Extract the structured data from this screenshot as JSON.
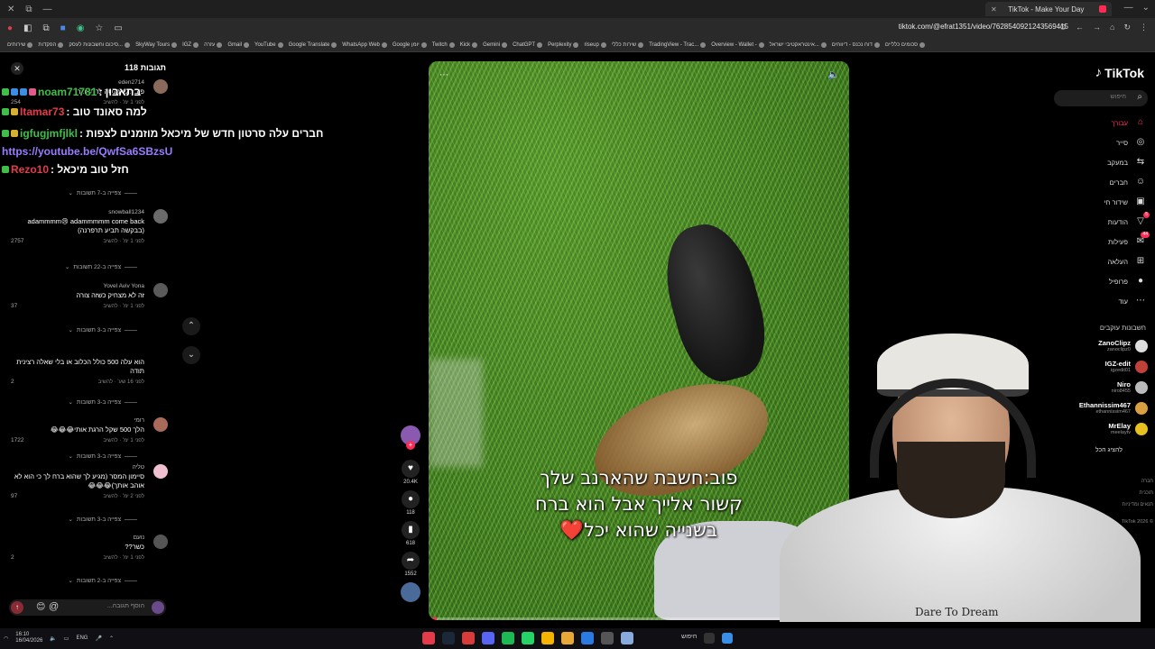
{
  "browser": {
    "tab_title": "TikTok - Make Your Day",
    "url": "tiktok.com/@efrat1351/video/7628540921243569415",
    "bookmarks": [
      "סכומים כלליים",
      "דוח נכנס - דיווחים",
      "אינטראקטיבי ישראל...",
      "Overview - Wallet -",
      "TradingView - Trac...",
      "שירות כללי",
      "riseup",
      "Perplexity",
      "ChatGPT",
      "Gemini",
      "Kick",
      "Twitch",
      "Google יומן",
      "WhatsApp Web",
      "Google Translate",
      "YouTube",
      "Gmail",
      "עזרה",
      "IGZ",
      "SkyWay Tours",
      "סיכום וחשבונות לעסק...",
      "הפקדות",
      "שירותים"
    ]
  },
  "comments": {
    "header": "תגובות",
    "count": "118",
    "close_icon": "close-icon",
    "items": [
      {
        "user": "eden2714",
        "text": "פוב: אני מנסה להתעורר",
        "meta": "לפני 1 ימ' · להשיב",
        "likes": "254",
        "replies": "צפייה ב-7 תשובות"
      },
      {
        "user": "snowball1234",
        "text": "adammmm😢 adammmmm come back (בבקשה תביע תרפרנה)",
        "meta": "לפני 1 ימ' · להשיב",
        "likes": "2757",
        "replies": "צפייה ב-22 תשובות"
      },
      {
        "user": "Yovel Aviv Yona",
        "text": "זה לא מצחיק כשזה צורה",
        "meta": "לפני 1 ימ' · להשיב",
        "likes": "37",
        "replies": "צפייה ב-3 תשובות"
      },
      {
        "user": "",
        "text": "הוא עלה 500 כולל הכלוב או בלי שאלה רצינית תודה",
        "meta": "לפני 16 שע' · להשיב",
        "likes": "2",
        "replies": "צפייה ב-3 תשובות"
      },
      {
        "user": "רומי",
        "text": "הלך 500 שקל הרגת אותי😂😂😂",
        "meta": "לפני 1 ימ' · להשיב",
        "likes": "1722",
        "replies": "צפייה ב-3 תשובות"
      },
      {
        "user": "טליה",
        "text": "סיימון המסר (מגיע לך שהוא ברח לך כי הוא לא אוהב אותך)😂😂😂",
        "meta": "לפני 2 ימ' · להשיב",
        "likes": "97",
        "replies": "צפייה ב-3 תשובות"
      },
      {
        "user": "נועם",
        "text": "כשר??",
        "meta": "לפני 1 ימ' · להשיב",
        "likes": "2",
        "replies": "צפייה ב-2 תשובות"
      }
    ],
    "input_placeholder": "הוסף תגובה...",
    "emoji_icon": "😊",
    "at_symbol": "@"
  },
  "chat": [
    {
      "name": "noam71781",
      "name_color": "#3fbf4a",
      "msg": ": בתאבון"
    },
    {
      "name": "Itamar73",
      "name_color": "#e23b4a",
      "msg": ": למה סאונד טוב"
    },
    {
      "name": "igfugjmfjlkl",
      "name_color": "#3fbf4a",
      "msg": ": חברים עלה סרטון חדש של מיכאל מוזמנים לצפות"
    },
    {
      "name": "https://youtube.be/QwfSa6SBzsU",
      "name_color": "#9a7cff",
      "msg": ""
    },
    {
      "name": "Rezo10",
      "name_color": "#e23b4a",
      "msg": ": חזל טוב מיכאל"
    }
  ],
  "video": {
    "caption": [
      "פוב:חשבת שהארנב שלך",
      "קשור אלייך אבל הוא ברח",
      "בשנייה שהוא יכל"
    ],
    "caption_heart": "❤️",
    "progress": 0.02
  },
  "actions": {
    "likes": "20.4K",
    "comments": "118",
    "saves": "618",
    "shares": "1552"
  },
  "tiktok": {
    "logo": "TikTok",
    "search_placeholder": "חיפוש",
    "nav": [
      {
        "label": "עבורך",
        "icon": "home-icon",
        "glyph": "⌂",
        "active": true,
        "badge": ""
      },
      {
        "label": "סייר",
        "icon": "compass-icon",
        "glyph": "◎",
        "active": false,
        "badge": ""
      },
      {
        "label": "במעקב",
        "icon": "following-icon",
        "glyph": "⇆",
        "active": false,
        "badge": ""
      },
      {
        "label": "חברים",
        "icon": "friends-icon",
        "glyph": "☺",
        "active": false,
        "badge": ""
      },
      {
        "label": "שידור חי",
        "icon": "live-icon",
        "glyph": "▣",
        "active": false,
        "badge": ""
      },
      {
        "label": "הודעות",
        "icon": "messages-icon",
        "glyph": "▽",
        "active": false,
        "badge": "5"
      },
      {
        "label": "פעילות",
        "icon": "activity-icon",
        "glyph": "✉",
        "active": false,
        "badge": "44"
      },
      {
        "label": "העלאה",
        "icon": "upload-icon",
        "glyph": "⊞",
        "active": false,
        "badge": ""
      },
      {
        "label": "פרופיל",
        "icon": "profile-icon",
        "glyph": "●",
        "active": false,
        "badge": ""
      },
      {
        "label": "עוד",
        "icon": "more-icon",
        "glyph": "⋯",
        "active": false,
        "badge": ""
      }
    ],
    "following_title": "חשבונות עוקבים",
    "accounts": [
      {
        "name": "ZanoClipz",
        "handle": "zanoclipz0"
      },
      {
        "name": "IGZ-edit",
        "handle": "igzedit01"
      },
      {
        "name": "Niro",
        "handle": "niro8455"
      },
      {
        "name": "Ethannissim467",
        "handle": "ethannissim467"
      },
      {
        "name": "MrElay",
        "handle": "meelaytv"
      }
    ],
    "show_all": "להציג הכל",
    "footer": [
      "חברה",
      "תוכנית",
      "תנאים ומדיניות",
      "TikTok 2026 ©"
    ]
  },
  "streamer": {
    "shirt_text": "Dare To Dream"
  },
  "taskbar": {
    "time": "16:10",
    "date": "16/04/2026",
    "lang": "ENG",
    "search": "חיפוש"
  }
}
